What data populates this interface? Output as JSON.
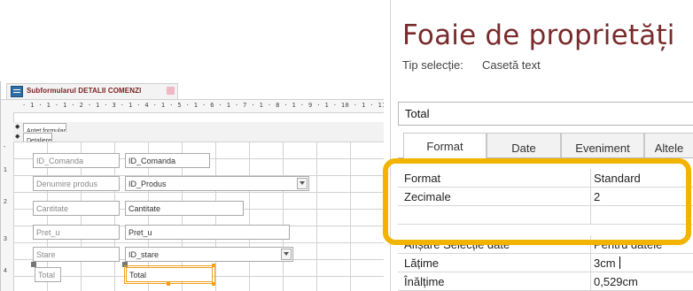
{
  "designer": {
    "tab_title": "Subformularul DETALII COMENZI",
    "ruler_text": "· 1 · 1 · 1 · 2 · 1 · 3 · 1 · 4 · 1 · 5 · 1 · 6 · 1 · 7 · 1 · 8 · 1 · 9 · 1 · 10 · 1 · 11 · 1 · 12 · 1",
    "vruler_ticks": [
      "-",
      "1",
      "2",
      "3",
      "4"
    ],
    "sections": {
      "header": "Antet formular",
      "detail": "Detaliere"
    },
    "fields": [
      {
        "label": "ID_Comanda",
        "control": "ID_Comanda"
      },
      {
        "label": "Denumire produs",
        "control": "ID_Produs"
      },
      {
        "label": "Cantitate",
        "control": "Cantitate"
      },
      {
        "label": "Pret_u",
        "control": "Pret_u"
      },
      {
        "label": "Stare",
        "control": "ID_stare"
      },
      {
        "label": "Total",
        "control": "Total"
      }
    ]
  },
  "property_sheet": {
    "title": "Foaie de proprietăți",
    "selection_type_label": "Tip selecție:",
    "selection_type_value": "Casetă text",
    "object_name": "Total",
    "tabs": [
      "Format",
      "Date",
      "Eveniment",
      "Altele"
    ],
    "active_tab": "Format",
    "rows": [
      {
        "name": "Format",
        "value": "Standard"
      },
      {
        "name": "Zecimale",
        "value": "2"
      },
      {
        "name": "",
        "value": ""
      },
      {
        "name": "Afișare Selecție date",
        "value": "Pentru datele"
      },
      {
        "name": "Lățime",
        "value": "3cm"
      },
      {
        "name": "Înălțime",
        "value": "0,529cm"
      }
    ]
  },
  "colors": {
    "highlight": "#f2b400",
    "title": "#7a2a2a",
    "tab_title": "#7a1f1f",
    "selection": "#f0a020"
  },
  "icons": [
    "form-icon",
    "close-icon",
    "chevron-down-icon"
  ]
}
